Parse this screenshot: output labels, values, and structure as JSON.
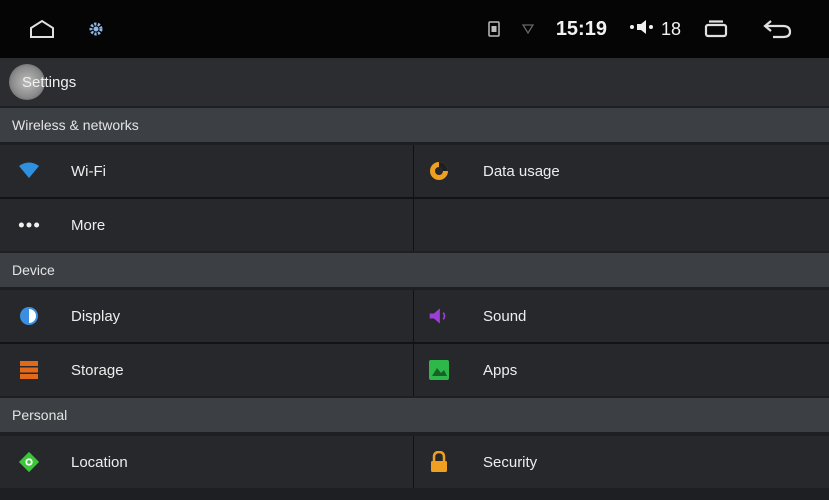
{
  "status_bar": {
    "time": "15:19",
    "volume": "18",
    "icons": [
      "home-icon",
      "settings-gear-icon",
      "sim-icon",
      "signal-icon",
      "volume-icon",
      "recents-icon",
      "back-icon"
    ]
  },
  "header": {
    "title": "Settings"
  },
  "sections": {
    "wireless": "Wireless & networks",
    "device": "Device",
    "personal": "Personal"
  },
  "items": {
    "wifi": "Wi-Fi",
    "data_usage": "Data usage",
    "more": "More",
    "display": "Display",
    "sound": "Sound",
    "storage": "Storage",
    "apps": "Apps",
    "location": "Location",
    "security": "Security"
  },
  "colors": {
    "wifi": "#2f8fe0",
    "data_usage": "#f0a020",
    "display": "#3a8fe0",
    "sound": "#9b3fd6",
    "storage": "#e06a1a",
    "apps": "#2fb84a",
    "location": "#3cc63a",
    "security": "#f0a020"
  }
}
